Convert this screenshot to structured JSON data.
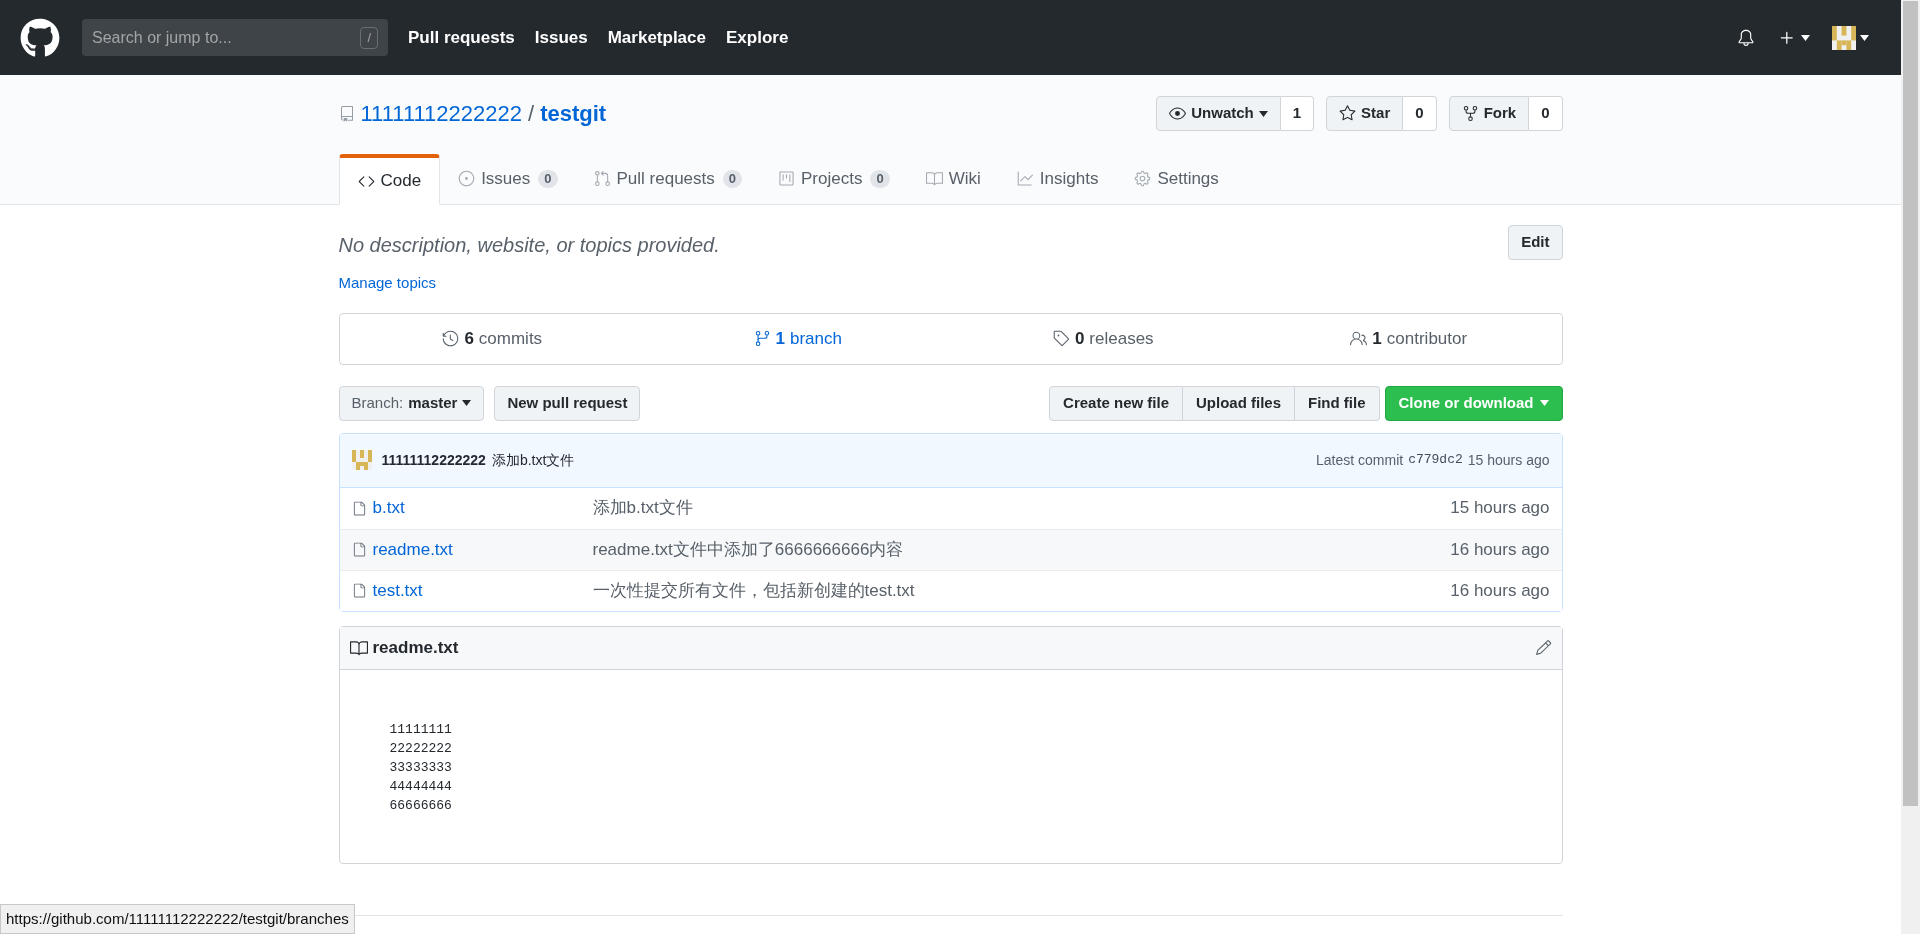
{
  "header": {
    "search_placeholder": "Search or jump to...",
    "search_key": "/",
    "nav": [
      "Pull requests",
      "Issues",
      "Marketplace",
      "Explore"
    ]
  },
  "repo": {
    "owner": "11111112222222",
    "separator": "/",
    "name": "testgit",
    "actions": [
      {
        "label": "Unwatch",
        "count": "1",
        "caret": true
      },
      {
        "label": "Star",
        "count": "0",
        "caret": false
      },
      {
        "label": "Fork",
        "count": "0",
        "caret": false
      }
    ],
    "tabs": [
      {
        "label": "Code",
        "selected": true
      },
      {
        "label": "Issues",
        "count": "0",
        "selected": false
      },
      {
        "label": "Pull requests",
        "count": "0",
        "selected": false
      },
      {
        "label": "Projects",
        "count": "0",
        "selected": false
      },
      {
        "label": "Wiki",
        "selected": false
      },
      {
        "label": "Insights",
        "selected": false
      },
      {
        "label": "Settings",
        "selected": false
      }
    ]
  },
  "description": "No description, website, or topics provided.",
  "edit_button": "Edit",
  "manage_topics": "Manage topics",
  "stats": [
    {
      "count": "6",
      "label": "commits",
      "hovered": false
    },
    {
      "count": "1",
      "label": "branch",
      "hovered": true
    },
    {
      "count": "0",
      "label": "releases",
      "hovered": false
    },
    {
      "count": "1",
      "label": "contributor",
      "hovered": false
    }
  ],
  "branch_select": {
    "label": "Branch:",
    "value": "master"
  },
  "new_pull_request": "New pull request",
  "file_actions": [
    "Create new file",
    "Upload files",
    "Find file"
  ],
  "clone_button": "Clone or download",
  "commit": {
    "author": "11111112222222",
    "message": "添加b.txt文件",
    "latest_label": "Latest commit",
    "sha": "c779dc2",
    "time": "15 hours ago"
  },
  "files": [
    {
      "name": "b.txt",
      "message": "添加b.txt文件",
      "time": "15 hours ago"
    },
    {
      "name": "readme.txt",
      "message": "readme.txt文件中添加了6666666666内容",
      "time": "16 hours ago"
    },
    {
      "name": "test.txt",
      "message": "一次性提交所有文件，包括新创建的test.txt",
      "time": "16 hours ago"
    }
  ],
  "readme": {
    "title": "readme.txt",
    "lines": [
      "11111111",
      "22222222",
      "33333333",
      "44444444",
      "66666666"
    ]
  },
  "status_url": "https://github.com/11111112222222/testgit/branches"
}
